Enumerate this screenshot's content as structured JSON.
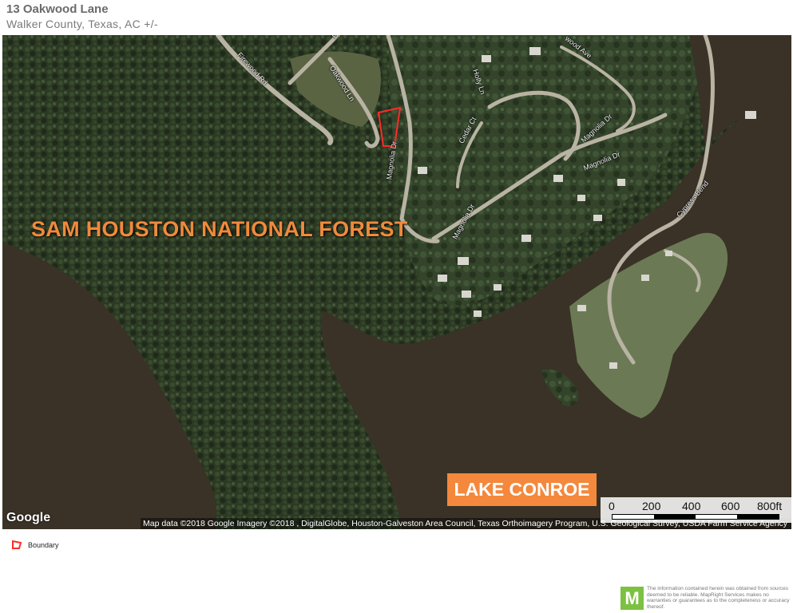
{
  "header": {
    "title": "13 Oakwood Lane",
    "subtitle": "Walker County, Texas,  AC +/-"
  },
  "map": {
    "view": "satellite",
    "roads": {
      "firewood": "Firewood Rd",
      "oakwood": "Oakwood Ln",
      "dr_top": "Dr",
      "oakwood_ave": "wood Ave",
      "holly": "Holly Ln",
      "cedar": "Cedar Ct",
      "magnolia_1": "Magnolia Dr",
      "magnolia_2": "Magnolia Dr",
      "magnolia_3": "Magnolia Dr",
      "magnolia_4": "Magnolia Dr",
      "cypress": "Cypress Bend"
    },
    "forest_label": "SAM HOUSTON NATIONAL FOREST",
    "lake_label": "LAKE CONROE",
    "google_logo": "Google",
    "attribution": "Map data ©2018 Google  Imagery ©2018 , DigitalGlobe, Houston-Galveston Area Council, Texas Orthoimagery Program, U.S. Geological Survey, USDA Farm Service Agency",
    "scale": {
      "labels": [
        "0",
        "200",
        "400",
        "600",
        "800ft"
      ]
    },
    "boundary_color": "#ff2a2a",
    "accent_color": "#f4883c"
  },
  "legend": {
    "items": [
      {
        "label": "Boundary",
        "icon": "boundary-icon"
      }
    ]
  },
  "footer": {
    "logo_letter": "M",
    "disclaimer": "The information contained herein was obtained from sources deemed to be reliable. MapRight Services makes no warranties or guarantees as to the completeness or accuracy thereof."
  }
}
